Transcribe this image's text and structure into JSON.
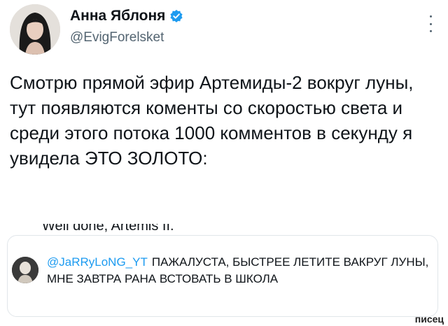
{
  "author": {
    "display_name": "Анна Яблоня",
    "handle": "@EvigForelsket",
    "verified_icon": "verified-badge-icon"
  },
  "menu": {
    "icon": "more-vertical-icon"
  },
  "tweet": {
    "text": "Смотрю прямой эфир Артемиды-2 вокруг луны, тут появляются коменты со скоростью света и среди этого потока 1000 комментов в секунду я увидела ЭТО ЗОЛОТО:"
  },
  "embedded": {
    "cut_off_line": "Well done, Artemis II.",
    "comment": {
      "handle": "@JaRRyLoNG_YT",
      "text": "ПАЖАЛУСТА, БЫСТРЕЕ ЛЕТИТЕ ВАКРУГ ЛУНЫ, МНЕ ЗАВТРА РАНА ВСТОВАТЬ В ШКОЛА"
    }
  },
  "watermark": "писец",
  "colors": {
    "accent": "#1d9bf0",
    "text": "#0f1419",
    "secondary": "#536471"
  }
}
